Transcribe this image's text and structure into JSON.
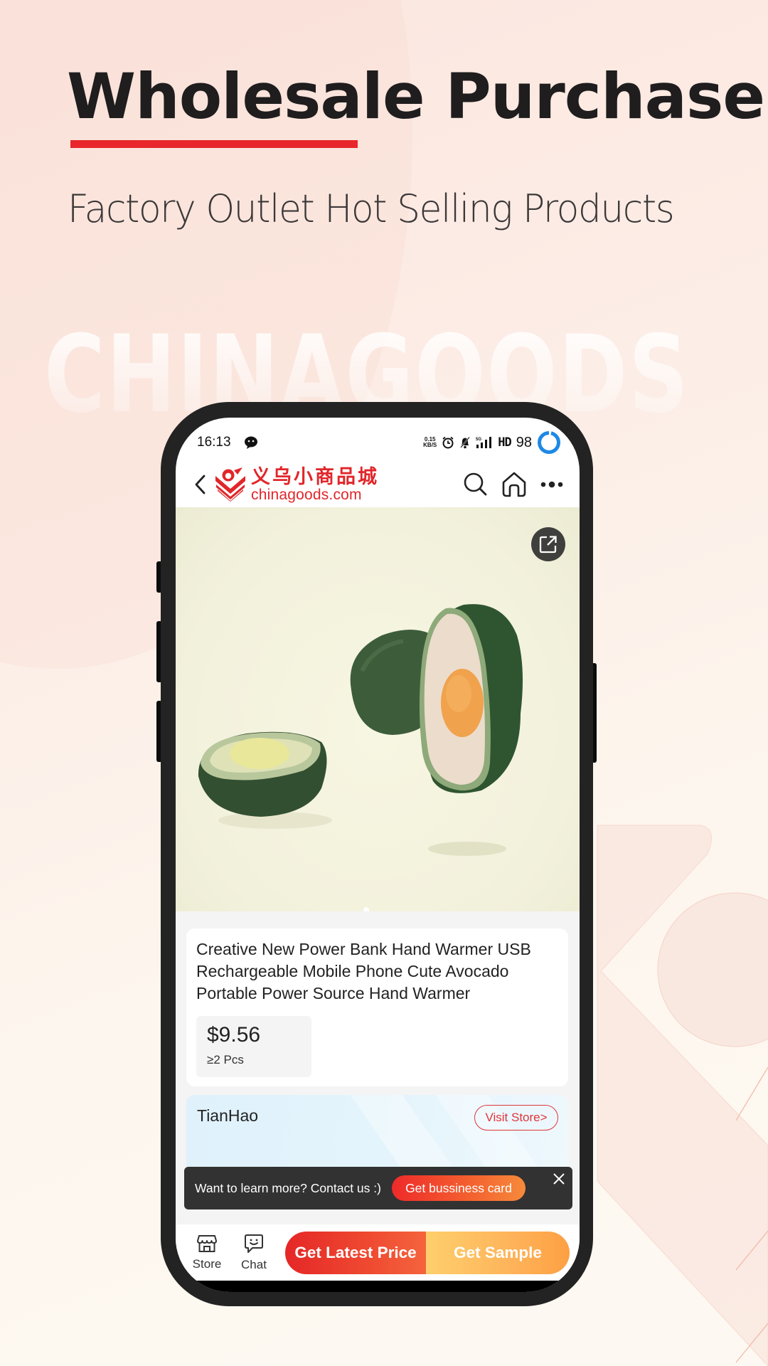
{
  "hero": {
    "title": "Wholesale Purchase",
    "subtitle": "Factory Outlet Hot Selling Products",
    "watermark": "CHINAGOODS",
    "accent_color": "#e8262b"
  },
  "status_bar": {
    "time": "16:13",
    "network_speed_value": "0.15",
    "network_speed_unit": "KB/S",
    "signal_label": "5G",
    "hd_label": "HD",
    "battery": "98",
    "icons": [
      "message-icon",
      "alarm-icon",
      "mute-icon",
      "signal-icon",
      "battery-ring-icon"
    ]
  },
  "navbar": {
    "logo_cn": "义乌小商品城",
    "logo_en": "chinagoods.com",
    "icons": [
      "back-icon",
      "search-icon",
      "home-icon",
      "more-icon"
    ],
    "brand_color": "#e1262a"
  },
  "gallery": {
    "image_alt": "Avocado-shaped power bank hand warmer",
    "current_slide": 1,
    "share_icon": "share-icon"
  },
  "product": {
    "title": "Creative New Power Bank Hand Warmer USB Rechargeable Mobile Phone Cute Avocado Portable Power Source Hand Warmer",
    "price": "$9.56",
    "moq": "≥2 Pcs"
  },
  "store": {
    "name": "TianHao",
    "visit_label": "Visit Store>"
  },
  "toast": {
    "text": "Want to learn more? Contact us :)",
    "button_label": "Get bussiness card"
  },
  "bottom_bar": {
    "tabs": [
      {
        "label": "Store",
        "icon": "store-icon"
      },
      {
        "label": "Chat",
        "icon": "chat-icon"
      }
    ],
    "primary_cta": "Get Latest Price",
    "secondary_cta": "Get Sample"
  }
}
